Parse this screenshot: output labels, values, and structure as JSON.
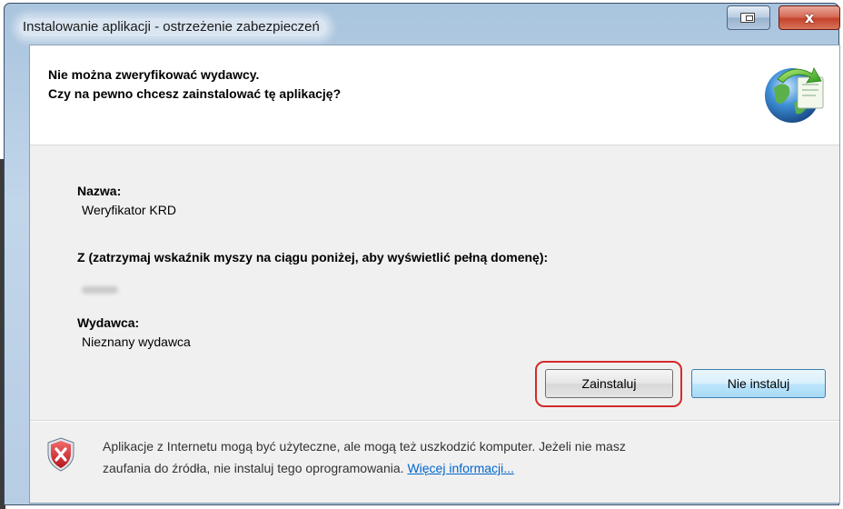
{
  "window": {
    "title": "Instalowanie aplikacji - ostrzeżenie zabezpieczeń",
    "close_glyph": "x"
  },
  "header": {
    "line1": "Nie można zweryfikować wydawcy.",
    "line2": "Czy na pewno chcesz zainstalować tę aplikację?",
    "icon": "globe-install-icon"
  },
  "fields": {
    "name_label": "Nazwa:",
    "name_value": "Weryfikator KRD",
    "from_label": "Z (zatrzymaj wskaźnik myszy na ciągu poniżej, aby wyświetlić pełną domenę):",
    "publisher_label": "Wydawca:",
    "publisher_value": "Nieznany wydawca"
  },
  "buttons": {
    "install": "Zainstaluj",
    "dont_install": "Nie instaluj"
  },
  "footer": {
    "text_line1": "Aplikacje z Internetu mogą być użyteczne, ale mogą też uszkodzić komputer. Jeżeli nie masz",
    "text_line2": "zaufania do źródła, nie instaluj tego oprogramowania.",
    "more_info_link": "Więcej informacji...",
    "icon": "shield-warning-icon"
  },
  "colors": {
    "highlight": "#d42a2a",
    "link": "#0066cc",
    "close_button": "#c4432a"
  }
}
